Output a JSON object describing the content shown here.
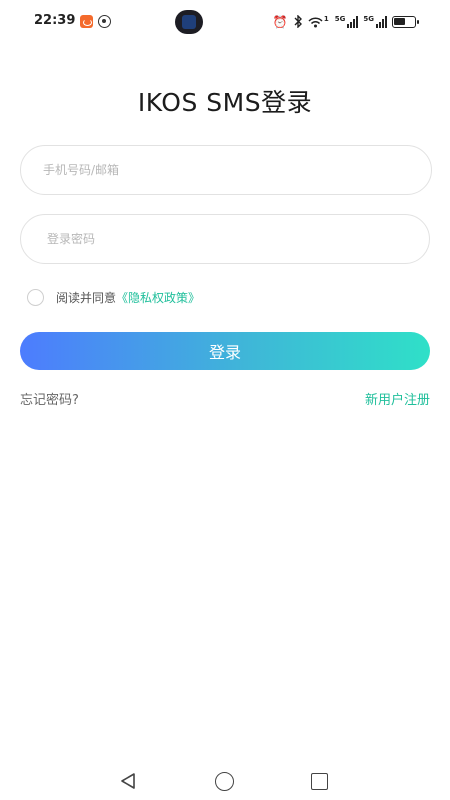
{
  "status_bar": {
    "time": "22:39",
    "left_icons": [
      "weibo-icon",
      "eye-icon"
    ],
    "right_icons": [
      "alarm-icon",
      "bluetooth-icon",
      "wifi-icon",
      "signal-5g-icon",
      "signal-5g-icon",
      "battery-icon"
    ],
    "wifi_suffix": "1",
    "signal_label": "5G",
    "battery_level": 0.6
  },
  "login": {
    "title": "IKOS SMS登录",
    "phone_placeholder": "手机号码/邮箱",
    "password_placeholder": "登录密码",
    "agreement_prefix": "阅读并同意",
    "privacy_link": "《隐私权政策》",
    "login_label": "登录",
    "forgot_password": "忘记密码?",
    "register": "新用户注册"
  },
  "colors": {
    "accent": "#1fbf9b",
    "button_gradient_start": "#4d7cfe",
    "button_gradient_end": "#2fe0c8"
  },
  "nav_bar": {
    "icons": [
      "back-icon",
      "home-icon",
      "recents-icon"
    ]
  }
}
